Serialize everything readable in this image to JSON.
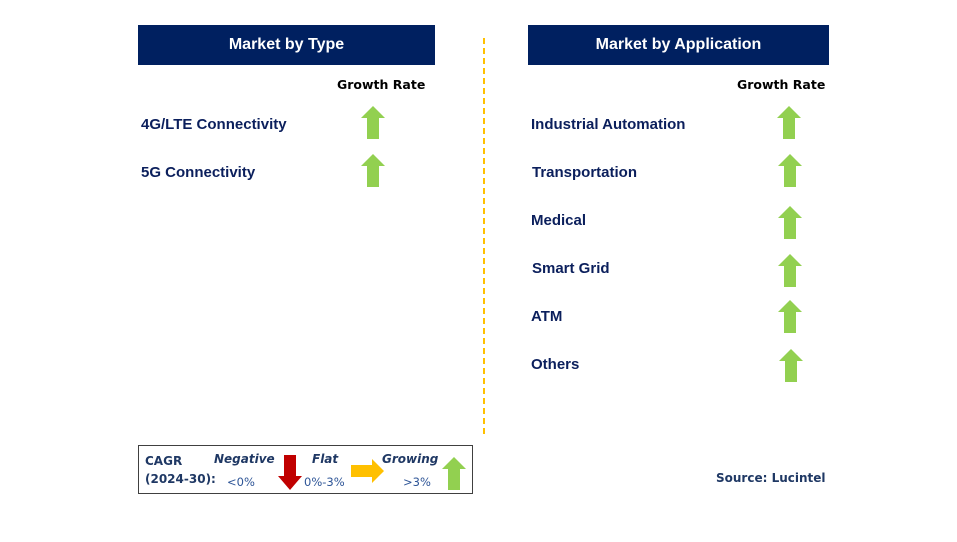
{
  "type_panel": {
    "title": "Market by Type",
    "growth_rate_label": "Growth Rate",
    "items": [
      {
        "label": "4G/LTE Connectivity",
        "trend": "growing"
      },
      {
        "label": "5G Connectivity",
        "trend": "growing"
      }
    ]
  },
  "application_panel": {
    "title": "Market by Application",
    "growth_rate_label": "Growth Rate",
    "items": [
      {
        "label": "Industrial Automation",
        "trend": "growing"
      },
      {
        "label": "Transportation",
        "trend": "growing"
      },
      {
        "label": "Medical",
        "trend": "growing"
      },
      {
        "label": "Smart Grid",
        "trend": "growing"
      },
      {
        "label": "ATM",
        "trend": "growing"
      },
      {
        "label": "Others",
        "trend": "growing"
      }
    ]
  },
  "legend": {
    "cagr_label": "CAGR",
    "period_label": "(2024-30):",
    "negative": {
      "label": "Negative",
      "range": "<0%",
      "icon": "arrow-down-icon",
      "color": "#c00000"
    },
    "flat": {
      "label": "Flat",
      "range": "0%-3%",
      "icon": "arrow-right-icon",
      "color": "#ffc000"
    },
    "growing": {
      "label": "Growing",
      "range": ">3%",
      "icon": "arrow-up-icon",
      "color": "#92d050"
    }
  },
  "source": "Source: Lucintel",
  "colors": {
    "header_bg": "#002060",
    "label_text": "#0b1f5c",
    "divider": "#ffc000",
    "growing": "#92d050"
  }
}
